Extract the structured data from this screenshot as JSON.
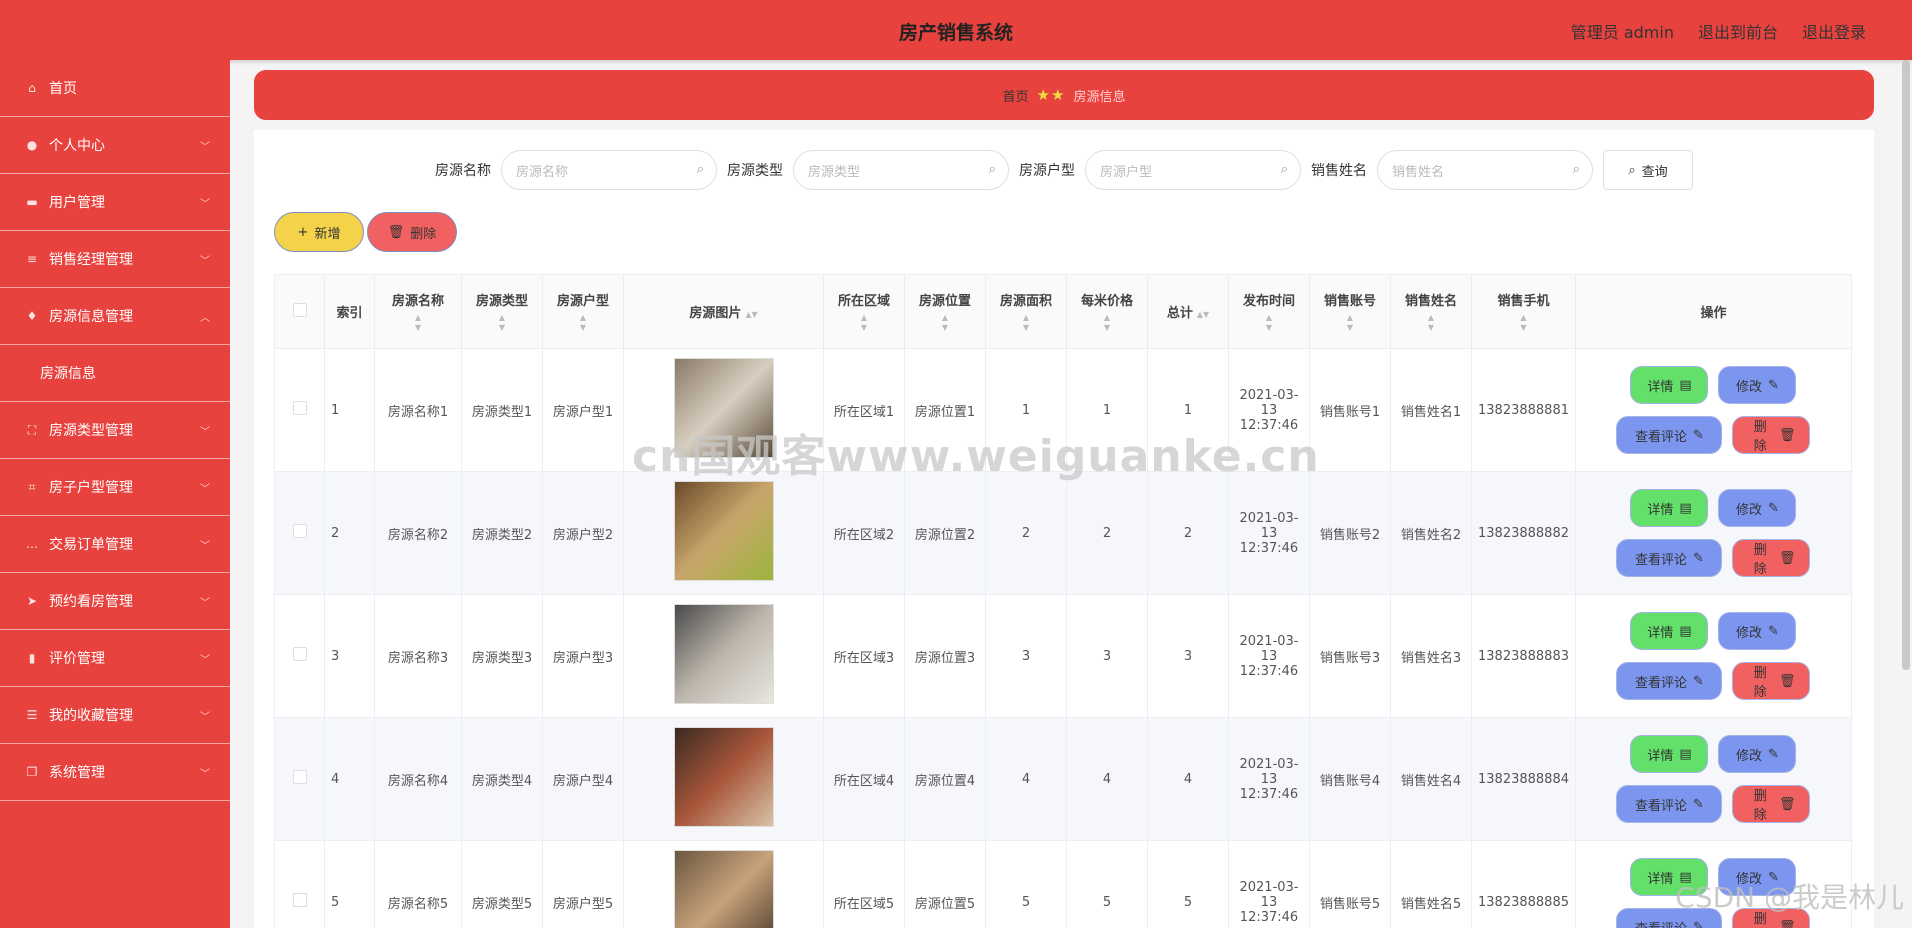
{
  "header": {
    "title": "房产销售系统",
    "user": "管理员 admin",
    "front_link": "退出到前台",
    "logout_link": "退出登录"
  },
  "sidebar": {
    "items": [
      {
        "label": "首页",
        "icon": "home-icon",
        "glyph": "⌂",
        "chevron": false
      },
      {
        "label": "个人中心",
        "icon": "person-icon",
        "glyph": "●",
        "chevron": true
      },
      {
        "label": "用户管理",
        "icon": "users-icon",
        "glyph": "▬",
        "chevron": true
      },
      {
        "label": "销售经理管理",
        "icon": "manager-icon",
        "glyph": "≡",
        "chevron": true
      },
      {
        "label": "房源信息管理",
        "icon": "microphone-icon",
        "glyph": "♦",
        "chevron": true,
        "open": true
      },
      {
        "label": "房源类型管理",
        "icon": "scan-icon",
        "glyph": "⛶",
        "chevron": true
      },
      {
        "label": "房子户型管理",
        "icon": "crop-icon",
        "glyph": "⌗",
        "chevron": true
      },
      {
        "label": "交易订单管理",
        "icon": "chat-icon",
        "glyph": "…",
        "chevron": true
      },
      {
        "label": "预约看房管理",
        "icon": "send-icon",
        "glyph": "➤",
        "chevron": true
      },
      {
        "label": "评价管理",
        "icon": "bar-chart-icon",
        "glyph": "▮",
        "chevron": true
      },
      {
        "label": "我的收藏管理",
        "icon": "list-icon",
        "glyph": "☰",
        "chevron": true
      },
      {
        "label": "系统管理",
        "icon": "copy-icon",
        "glyph": "❐",
        "chevron": true
      }
    ],
    "submenu_label": "房源信息"
  },
  "breadcrumb": {
    "home": "首页",
    "current": "房源信息"
  },
  "search": {
    "name_label": "房源名称",
    "name_placeholder": "房源名称",
    "type_label": "房源类型",
    "type_placeholder": "房源类型",
    "layout_label": "房源户型",
    "layout_placeholder": "房源户型",
    "seller_label": "销售姓名",
    "seller_placeholder": "销售姓名",
    "query_button": "查询"
  },
  "actions": {
    "add": "新增",
    "delete": "删除"
  },
  "table": {
    "columns": [
      "索引",
      "房源名称",
      "房源类型",
      "房源户型",
      "房源图片",
      "所在区域",
      "房源位置",
      "房源面积",
      "每米价格",
      "总计",
      "发布时间",
      "销售账号",
      "销售姓名",
      "销售手机",
      "操作"
    ],
    "buttons": {
      "detail": "详情",
      "edit": "修改",
      "review": "查看评论",
      "remove": "删除"
    },
    "rows": [
      {
        "index": "1",
        "name": "房源名称1",
        "type": "房源类型1",
        "layout": "房源户型1",
        "area_region": "所在区域1",
        "location": "房源位置1",
        "size": "1",
        "price": "1",
        "total": "1",
        "time": "2021-03-13 12:37:46",
        "account": "销售账号1",
        "seller": "销售姓名1",
        "phone": "13823888881",
        "img": [
          "#8a7a68",
          "#d8cfc0",
          "#5b4a3a"
        ]
      },
      {
        "index": "2",
        "name": "房源名称2",
        "type": "房源类型2",
        "layout": "房源户型2",
        "area_region": "所在区域2",
        "location": "房源位置2",
        "size": "2",
        "price": "2",
        "total": "2",
        "time": "2021-03-13 12:37:46",
        "account": "销售账号2",
        "seller": "销售姓名2",
        "phone": "13823888882",
        "img": [
          "#6b4a2a",
          "#c9a66b",
          "#9cb43c"
        ]
      },
      {
        "index": "3",
        "name": "房源名称3",
        "type": "房源类型3",
        "layout": "房源户型3",
        "area_region": "所在区域3",
        "location": "房源位置3",
        "size": "3",
        "price": "3",
        "total": "3",
        "time": "2021-03-13 12:37:46",
        "account": "销售账号3",
        "seller": "销售姓名3",
        "phone": "13823888883",
        "img": [
          "#4a4a4a",
          "#bdb6ac",
          "#e9e6e0"
        ]
      },
      {
        "index": "4",
        "name": "房源名称4",
        "type": "房源类型4",
        "layout": "房源户型4",
        "area_region": "所在区域4",
        "location": "房源位置4",
        "size": "4",
        "price": "4",
        "total": "4",
        "time": "2021-03-13 12:37:46",
        "account": "销售账号4",
        "seller": "销售姓名4",
        "phone": "13823888884",
        "img": [
          "#3a2a22",
          "#a8563a",
          "#d8c3a6"
        ]
      },
      {
        "index": "5",
        "name": "房源名称5",
        "type": "房源类型5",
        "layout": "房源户型5",
        "area_region": "所在区域5",
        "location": "房源位置5",
        "size": "5",
        "price": "5",
        "total": "5",
        "time": "2021-03-13 12:37:46",
        "account": "销售账号5",
        "seller": "销售姓名5",
        "phone": "13823888885",
        "img": [
          "#6a5640",
          "#c8a27a",
          "#4a3a2c"
        ]
      }
    ]
  },
  "watermarks": {
    "center": "cn国观客www.weiguanke.cn",
    "corner": "CSDN @我是林儿"
  },
  "colors": {
    "primary_red": "#e8423f",
    "add_yellow": "#f4d34b",
    "delete_red": "#f26161",
    "detail_green": "#63e069",
    "edit_blue": "#7c96ef"
  }
}
